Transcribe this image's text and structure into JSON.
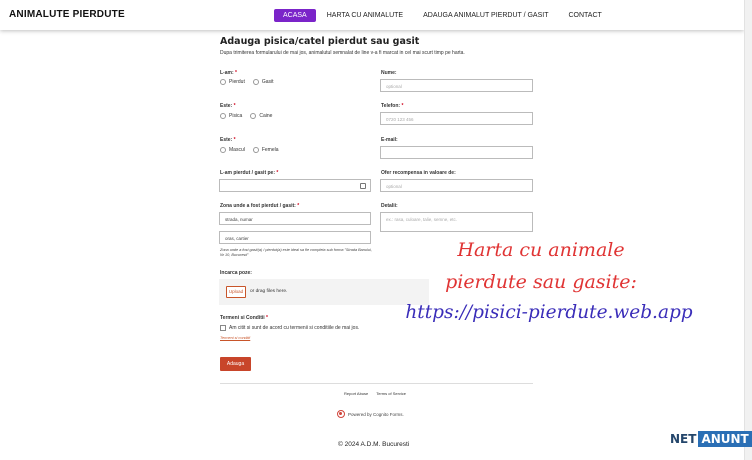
{
  "header": {
    "brand": "ANIMALUTE PIERDUTE",
    "nav": [
      "ACASA",
      "HARTA CU ANIMALUTE",
      "ADAUGA ANIMALUT PIERDUT / GASIT",
      "CONTACT"
    ],
    "active_nav": "ACASA",
    "accent_color": "#7b24c9"
  },
  "form": {
    "title": "Adauga pisica/catel pierdut sau gasit",
    "description": "Dupa trimiterea formularului de mai jos, animalutul semnalat de line v-a fi marcat in cel mai scurt timp pe harta.",
    "lost_found": {
      "label": "L-am:",
      "options": [
        "Pierdut",
        "Gasit"
      ]
    },
    "species": {
      "label": "Este:",
      "options": [
        "Pisica",
        "Caine"
      ]
    },
    "sex": {
      "label": "Este:",
      "options": [
        "Mascul",
        "Femela"
      ]
    },
    "date": {
      "label": "L-am pierdut / gasit pe:",
      "value": ""
    },
    "zone": {
      "label": "Zona unde a fost pierdut / gasit:",
      "street": "strada, numar",
      "area": "oras, cartier",
      "hint": "Zona unde a fost gasit(a) / pierdut(a) este ideal sa fie completa sub forma \"Strada Banului, Nr 10, Bucuresti\""
    },
    "name": {
      "label": "Nume:",
      "placeholder": "optional"
    },
    "phone": {
      "label": "Telefon:",
      "placeholder": "0720 123 456"
    },
    "email": {
      "label": "E-mail:",
      "placeholder": ""
    },
    "reward": {
      "label": "Ofer recompensa in valoare de:",
      "placeholder": "optional"
    },
    "details": {
      "label": "Detalii:",
      "placeholder": "ex.: rasa, culoare, talie, semne, etc."
    },
    "upload": {
      "label": "Incarca poze:",
      "button": "Upload",
      "text": "or drag files here."
    },
    "terms": {
      "label": "Termeni si Conditii",
      "checkbox": "Am citit si sunt de acord cu termenii si conditiile de mai jos.",
      "link": "Termeni si conditii"
    },
    "submit": "Adauga",
    "required_mark": "*"
  },
  "footer": {
    "links": [
      "Report Abuse",
      "Terms of Service"
    ],
    "powered": "Powered by Cognito Forms.",
    "copyright": "© 2024 A.D.M. Bucuresti"
  },
  "overlay": {
    "line1": "Harta cu animale",
    "line2": "pierdute sau gasite:",
    "line3": "https://pisici-pierdute.web.app"
  },
  "logo": {
    "net": "NET",
    "anunt": "ANUNT"
  }
}
